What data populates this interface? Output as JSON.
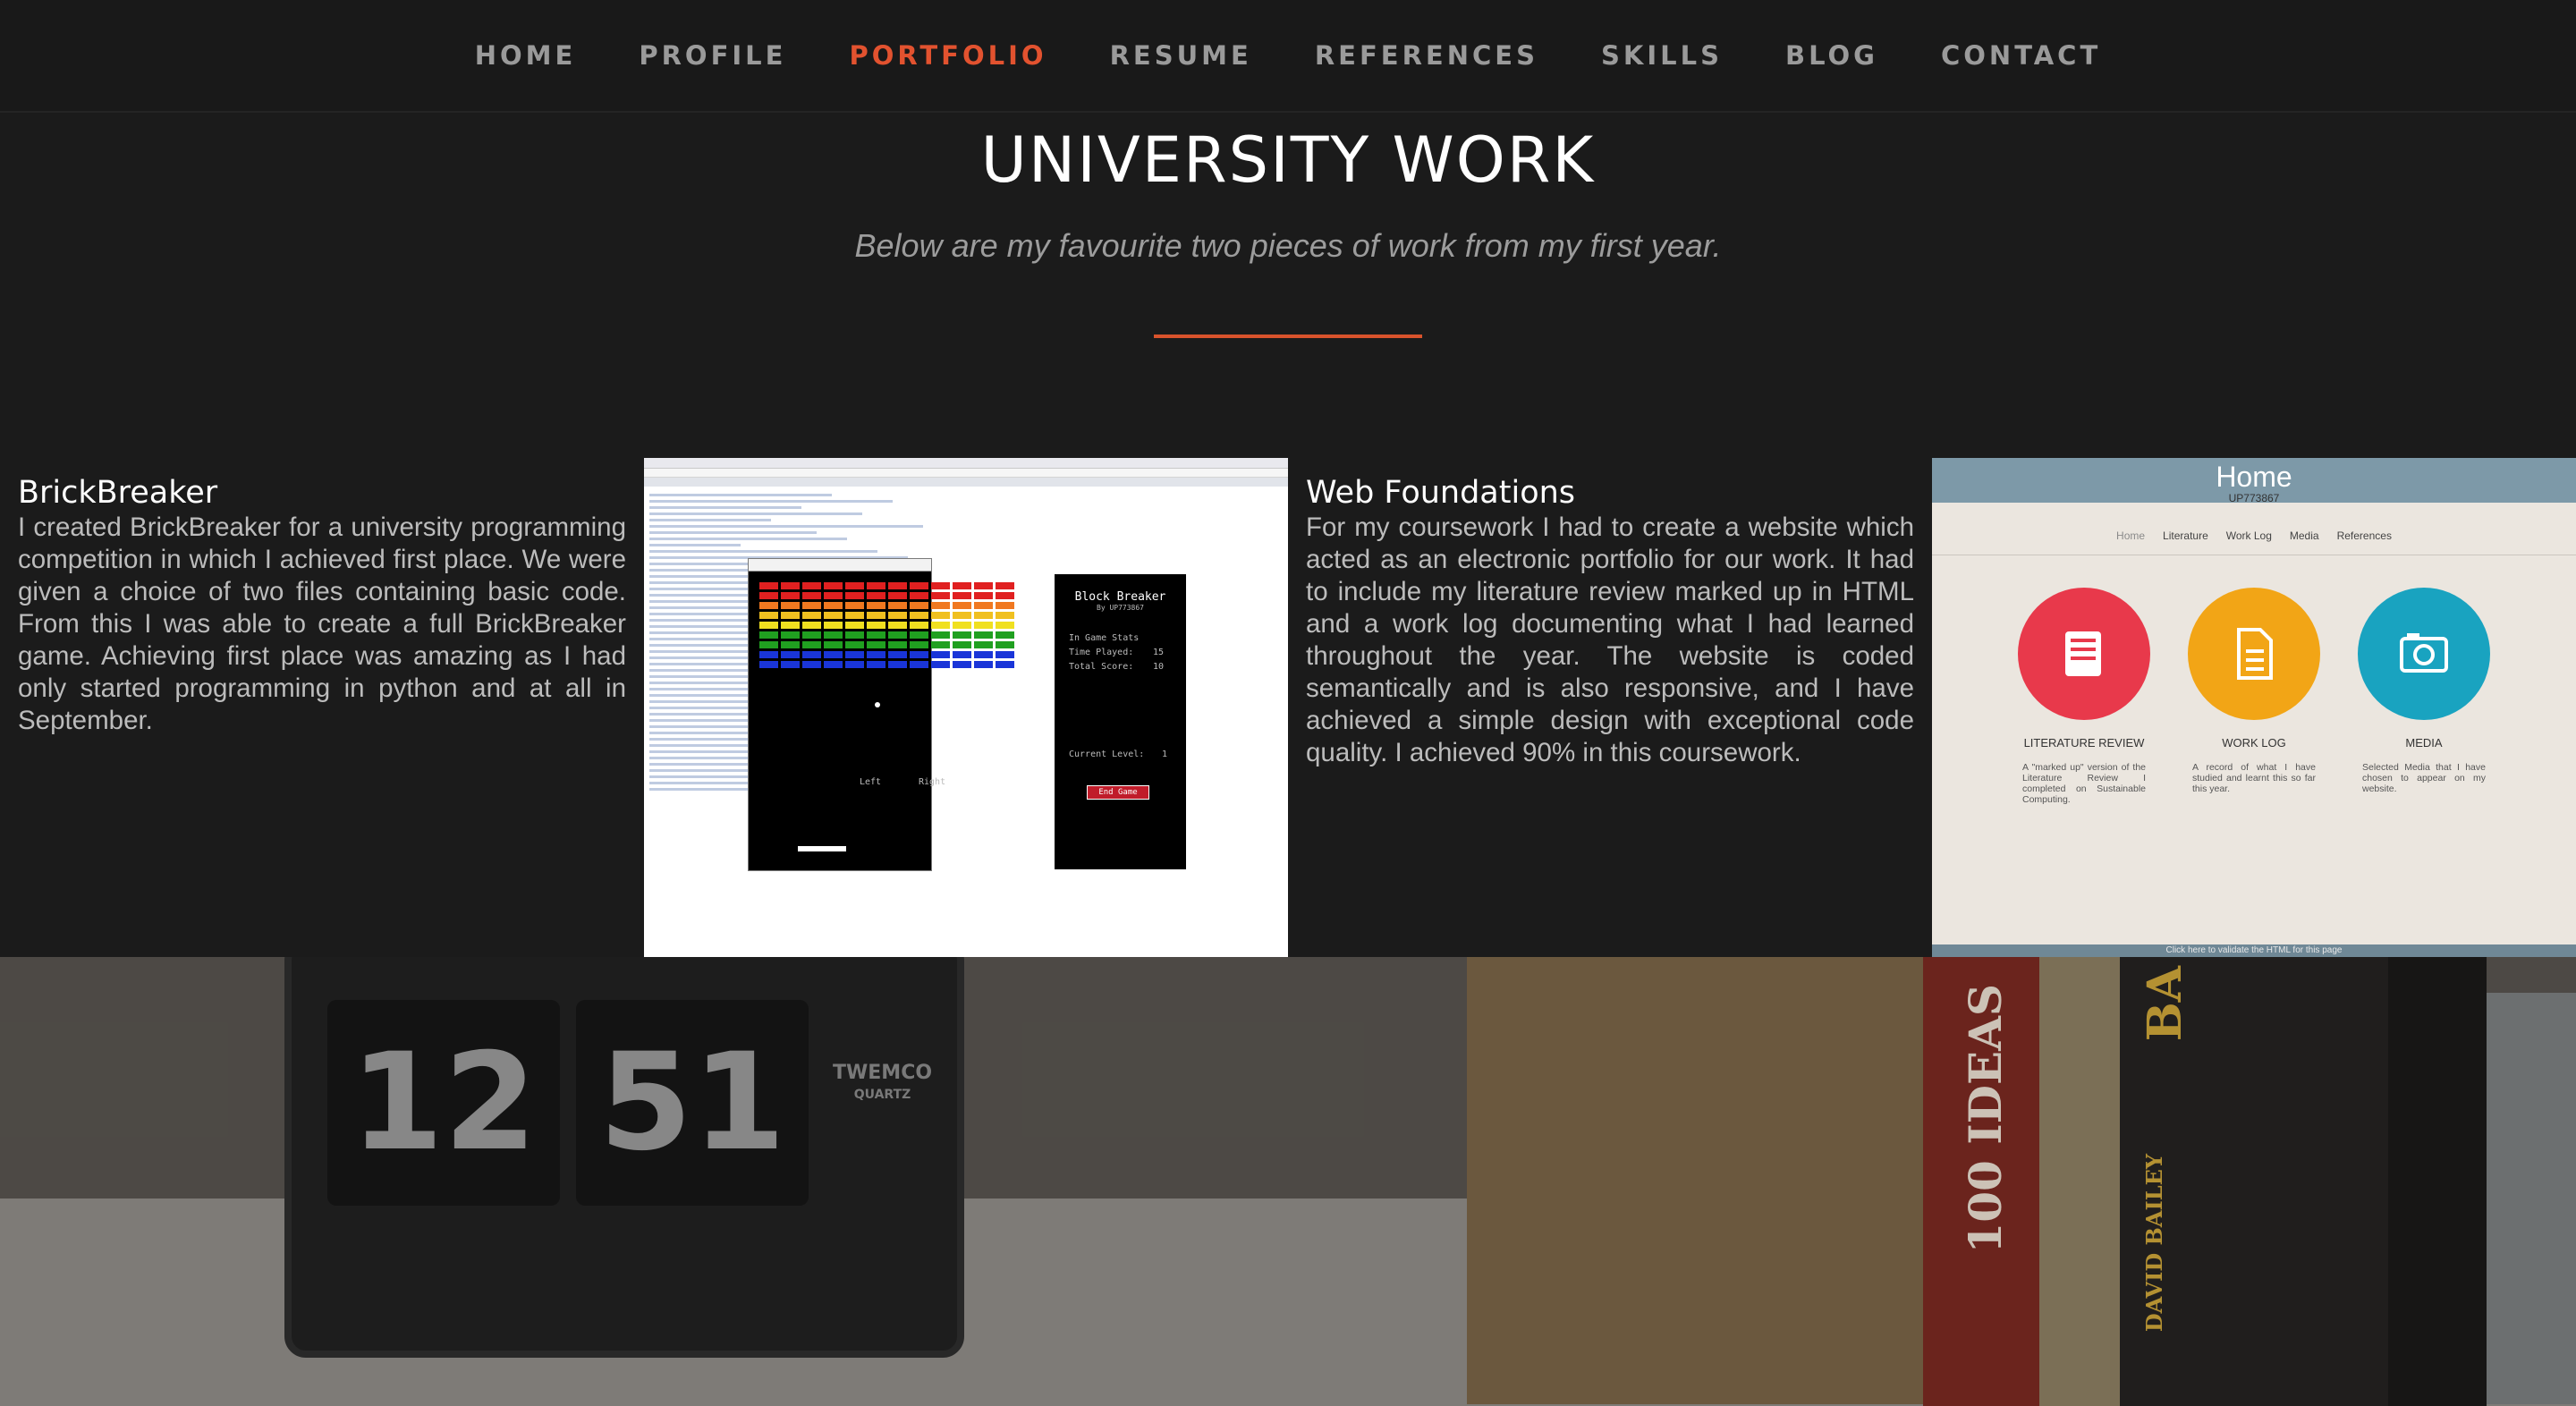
{
  "nav": {
    "items": [
      "HOME",
      "PROFILE",
      "PORTFOLIO",
      "RESUME",
      "REFERENCES",
      "SKILLS",
      "BLOG",
      "CONTACT"
    ],
    "active": "PORTFOLIO"
  },
  "header": {
    "title": "UNIVERSITY WORK",
    "subtitle": "Below are my favourite two pieces of work from my first year."
  },
  "works": [
    {
      "title": "BrickBreaker",
      "description": "I created BrickBreaker for a university programming competition in which I achieved first place. We were given a choice of two files containing basic code. From this I was able to create a full BrickBreaker game. Achieving first place was amazing as I had only started programming in python and at all in September."
    },
    {
      "title": "Web Foundations",
      "description": "For my coursework I had to create a website which acted as an electronic portfolio for our work. It had to include my literature review marked up in HTML and a work log documenting what I had learned throughout the year. The website is coded semantically and is also responsive, and I have achieved a simple design with exceptional code quality. I achieved 90% in this coursework."
    }
  ],
  "brickbreaker_shot": {
    "game_title": "Block Breaker",
    "by": "By UP773867",
    "stats_heading": "In Game Stats",
    "time_label": "Time Played:",
    "time_value": "15",
    "score_label": "Total Score:",
    "score_value": "10",
    "level_label": "Current Level:",
    "level_value": "1",
    "end_label": "End Game",
    "left_hint": "Left",
    "right_hint": "Right"
  },
  "web_shot": {
    "home": "Home",
    "id": "UP773867",
    "nav": [
      "Home",
      "Literature",
      "Work Log",
      "Media",
      "References"
    ],
    "cards": [
      {
        "label": "LITERATURE REVIEW",
        "text": "A \"marked up\" version of the Literature Review I completed on Sustainable Computing.",
        "color": "#e8394b",
        "icon": "book-icon"
      },
      {
        "label": "WORK LOG",
        "text": "A record of what I have studied and learnt this so far this year.",
        "color": "#f2a516",
        "icon": "document-icon"
      },
      {
        "label": "MEDIA",
        "text": "Selected Media that I have chosen to appear on my website.",
        "color": "#19a3c0",
        "icon": "camera-icon"
      }
    ],
    "footer": "Click here to validate the HTML for this page"
  },
  "photo": {
    "clock_hours": "12",
    "clock_minutes": "51",
    "clock_brand": "TWEMCO",
    "clock_sub": "QUARTZ",
    "book_red": "100 IDEAS",
    "book_cream": "BA",
    "book_dark": "DAVID BAILEY"
  },
  "colors": {
    "accent": "#e2522f",
    "background": "#1b1b1b",
    "nav_text": "#9a9a9a"
  }
}
